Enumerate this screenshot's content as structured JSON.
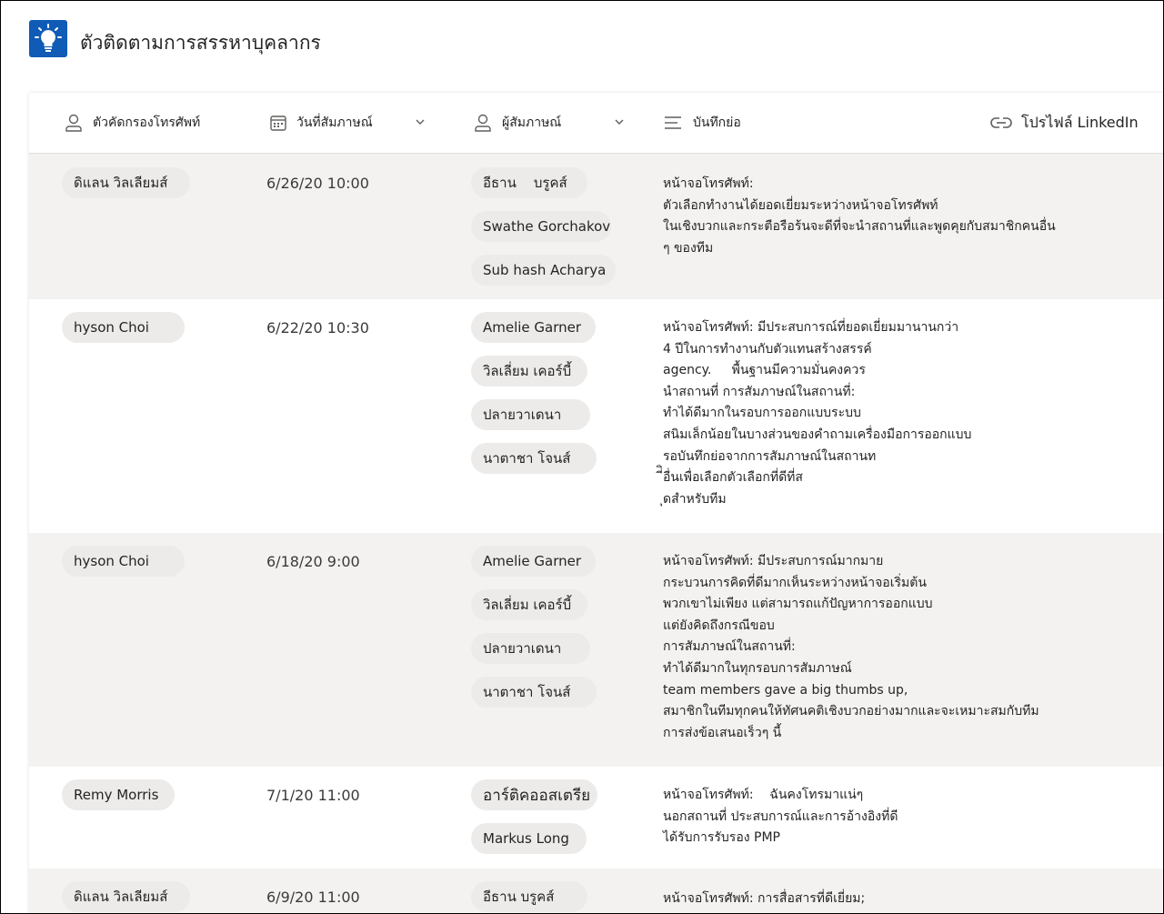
{
  "app": {
    "title": "ตัวติดตามการสรรหาบุคลากร",
    "icon": "lightbulb-icon",
    "accent": "#0f5bb6"
  },
  "columns": {
    "candidate": "ตัวคัดกรองโทรศัพท์",
    "date": "วันที่สัมภาษณ์",
    "interviewer": "ผู้สัมภาษณ์",
    "notes": "บันทึกย่อ",
    "linkedin": "โปรไฟล์ LinkedIn"
  },
  "rows": [
    {
      "candidate": "ดิแลน วิลเลียมส์",
      "date": "6/26/20 10:00",
      "interviewers": [
        "อีธาน    บรูคส์",
        "Swathe Gorchakov",
        "Sub hash Acharya"
      ],
      "notes": [
        "หน้าจอโทรศัพท์:",
        "ตัวเลือกทำงานได้ยอดเยี่ยมระหว่างหน้าจอโทรศัพท์",
        "ในเชิงบวกและกระตือรือร้นจะดีที่จะนำสถานที่และพูดคุยกับสมาชิกคนอื่น",
        "ๆ ของทีม"
      ]
    },
    {
      "candidate": "hyson Choi",
      "date": "6/22/20 10:30",
      "interviewers": [
        "Amelie Garner",
        "วิลเลี่ยม เคอร์บี้",
        "ปลายวาเดนา",
        "นาตาชา โจนส์"
      ],
      "notes": [
        "หน้าจอโทรศัพท์: มีประสบการณ์ที่ยอดเยี่ยมมานานกว่า",
        "4 ปีในการทำงานกับตัวแทนสร้างสรรค์",
        "agency.     พื้นฐานมีความมั่นคงควร",
        "นำสถานที่ การสัมภาษณ์ในสถานที่:",
        "ทำได้ดีมากในรอบการออกแบบระบบ",
        "สนิมเล็กน้อยในบางส่วนของคำถามเครื่องมือการออกแบบ",
        "รอบันทึกย่อจากการสัมภาษณ์ในสถานท",
        "ี่ิอื่นเพื่อเลือกตัวเลือกที่ดีที่ส",
        "ุดสำหรับทีม"
      ]
    },
    {
      "candidate": "hyson Choi",
      "date": "6/18/20 9:00",
      "interviewers": [
        "Amelie Garner",
        "วิลเลี่ยม เคอร์บี้",
        "ปลายวาเดนา",
        "นาตาชา โจนส์"
      ],
      "notes": [
        "หน้าจอโทรศัพท์: มีประสบการณ์มากมาย",
        "กระบวนการคิดที่ดีมากเห็นระหว่างหน้าจอเริ่มต้น",
        "พวกเขาไม่เพียง แต่สามารถแก้ปัญหาการออกแบบ",
        "แต่ยังคิดถึงกรณีขอบ",
        "การสัมภาษณ์ในสถานที่:",
        "ทำได้ดีมากในทุกรอบการสัมภาษณ์",
        "team members gave a big thumbs up,",
        "สมาชิกในทีมทุกคนให้ทัศนคติเชิงบวกอย่างมากและจะเหมาะสมกับทีม",
        "การส่งข้อเสนอเร็วๆ นี้"
      ]
    },
    {
      "candidate": "Remy Morris",
      "date": "7/1/20 11:00",
      "interviewers": [
        "อาร์ติคออสเตรีย",
        "Markus Long"
      ],
      "notes": [
        "หน้าจอโทรศัพท์:    ฉันคงโทรมาแน่ๆ",
        "นอกสถานที่ ประสบการณ์และการอ้างอิงที่ดี",
        "ได้รับการรับรอง PMP"
      ]
    },
    {
      "candidate": "ดิแลน วิลเลียมส์",
      "date": "6/9/20 11:00",
      "interviewers": [
        "อีธาน บรูคส์"
      ],
      "notes": [
        "หน้าจอโทรศัพท์: การสื่อสารที่ดีเยี่ยม;"
      ]
    }
  ]
}
